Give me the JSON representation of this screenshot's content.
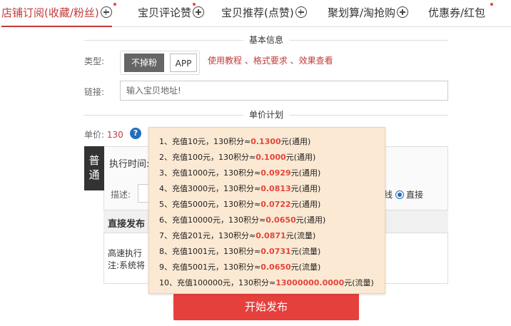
{
  "tabs": [
    {
      "label": "店铺订阅(收藏/粉丝)",
      "active": true
    },
    {
      "label": "宝贝评论赞",
      "active": false
    },
    {
      "label": "宝贝推荐(点赞)",
      "active": false
    },
    {
      "label": "聚划算/淘抢购",
      "active": false
    },
    {
      "label": "优惠券/红包",
      "active": false
    }
  ],
  "basic_info": {
    "title": "基本信息",
    "type_label": "类型:",
    "type_options": [
      "不掉粉",
      "APP"
    ],
    "selected_type": "不掉粉",
    "help_links": "使用教程 、格式要求 、效果查看",
    "link_label": "链接:",
    "link_placeholder": "输入宝贝地址!"
  },
  "price_plan": {
    "title": "单价计划",
    "price_label": "单价:",
    "price_value": "130",
    "help_icon": "question-icon"
  },
  "plan": {
    "normal_tag": "普通",
    "exec_time_label": "执行时间:",
    "desc_label": "描述:",
    "radio_partial": "线",
    "radio_direct": "直接"
  },
  "direct": {
    "title": "直接发布",
    "fast_exec": "高速执行",
    "note": "注:系统将"
  },
  "start_button": "开始发布",
  "recharge_popup": [
    {
      "prefix": "1、充值10元，130积分≈",
      "price": "0.1300",
      "suffix": "元(通用)"
    },
    {
      "prefix": "2、充值100元，130积分≈",
      "price": "0.1000",
      "suffix": "元(通用)"
    },
    {
      "prefix": "3、充值1000元，130积分≈",
      "price": "0.0929",
      "suffix": "元(通用)"
    },
    {
      "prefix": "4、充值3000元，130积分≈",
      "price": "0.0813",
      "suffix": "元(通用)"
    },
    {
      "prefix": "5、充值5000元，130积分≈",
      "price": "0.0722",
      "suffix": "元(通用)"
    },
    {
      "prefix": "6、充值10000元，130积分≈",
      "price": "0.0650",
      "suffix": "元(通用)"
    },
    {
      "prefix": "7、充值201元，130积分≈",
      "price": "0.0871",
      "suffix": "元(流量)"
    },
    {
      "prefix": "8、充值1001元，130积分≈",
      "price": "0.0731",
      "suffix": "元(流量)"
    },
    {
      "prefix": "9、充值5001元，130积分≈",
      "price": "0.0650",
      "suffix": "元(流量)"
    },
    {
      "prefix": "10、充值100000元，130积分≈",
      "price": "13000000.0000",
      "suffix": "元(流量)"
    }
  ],
  "colors": {
    "accent": "#c23a3a",
    "button": "#e6403d",
    "popup_bg": "#fbe9d3",
    "help_icon": "#1f6fc1"
  }
}
